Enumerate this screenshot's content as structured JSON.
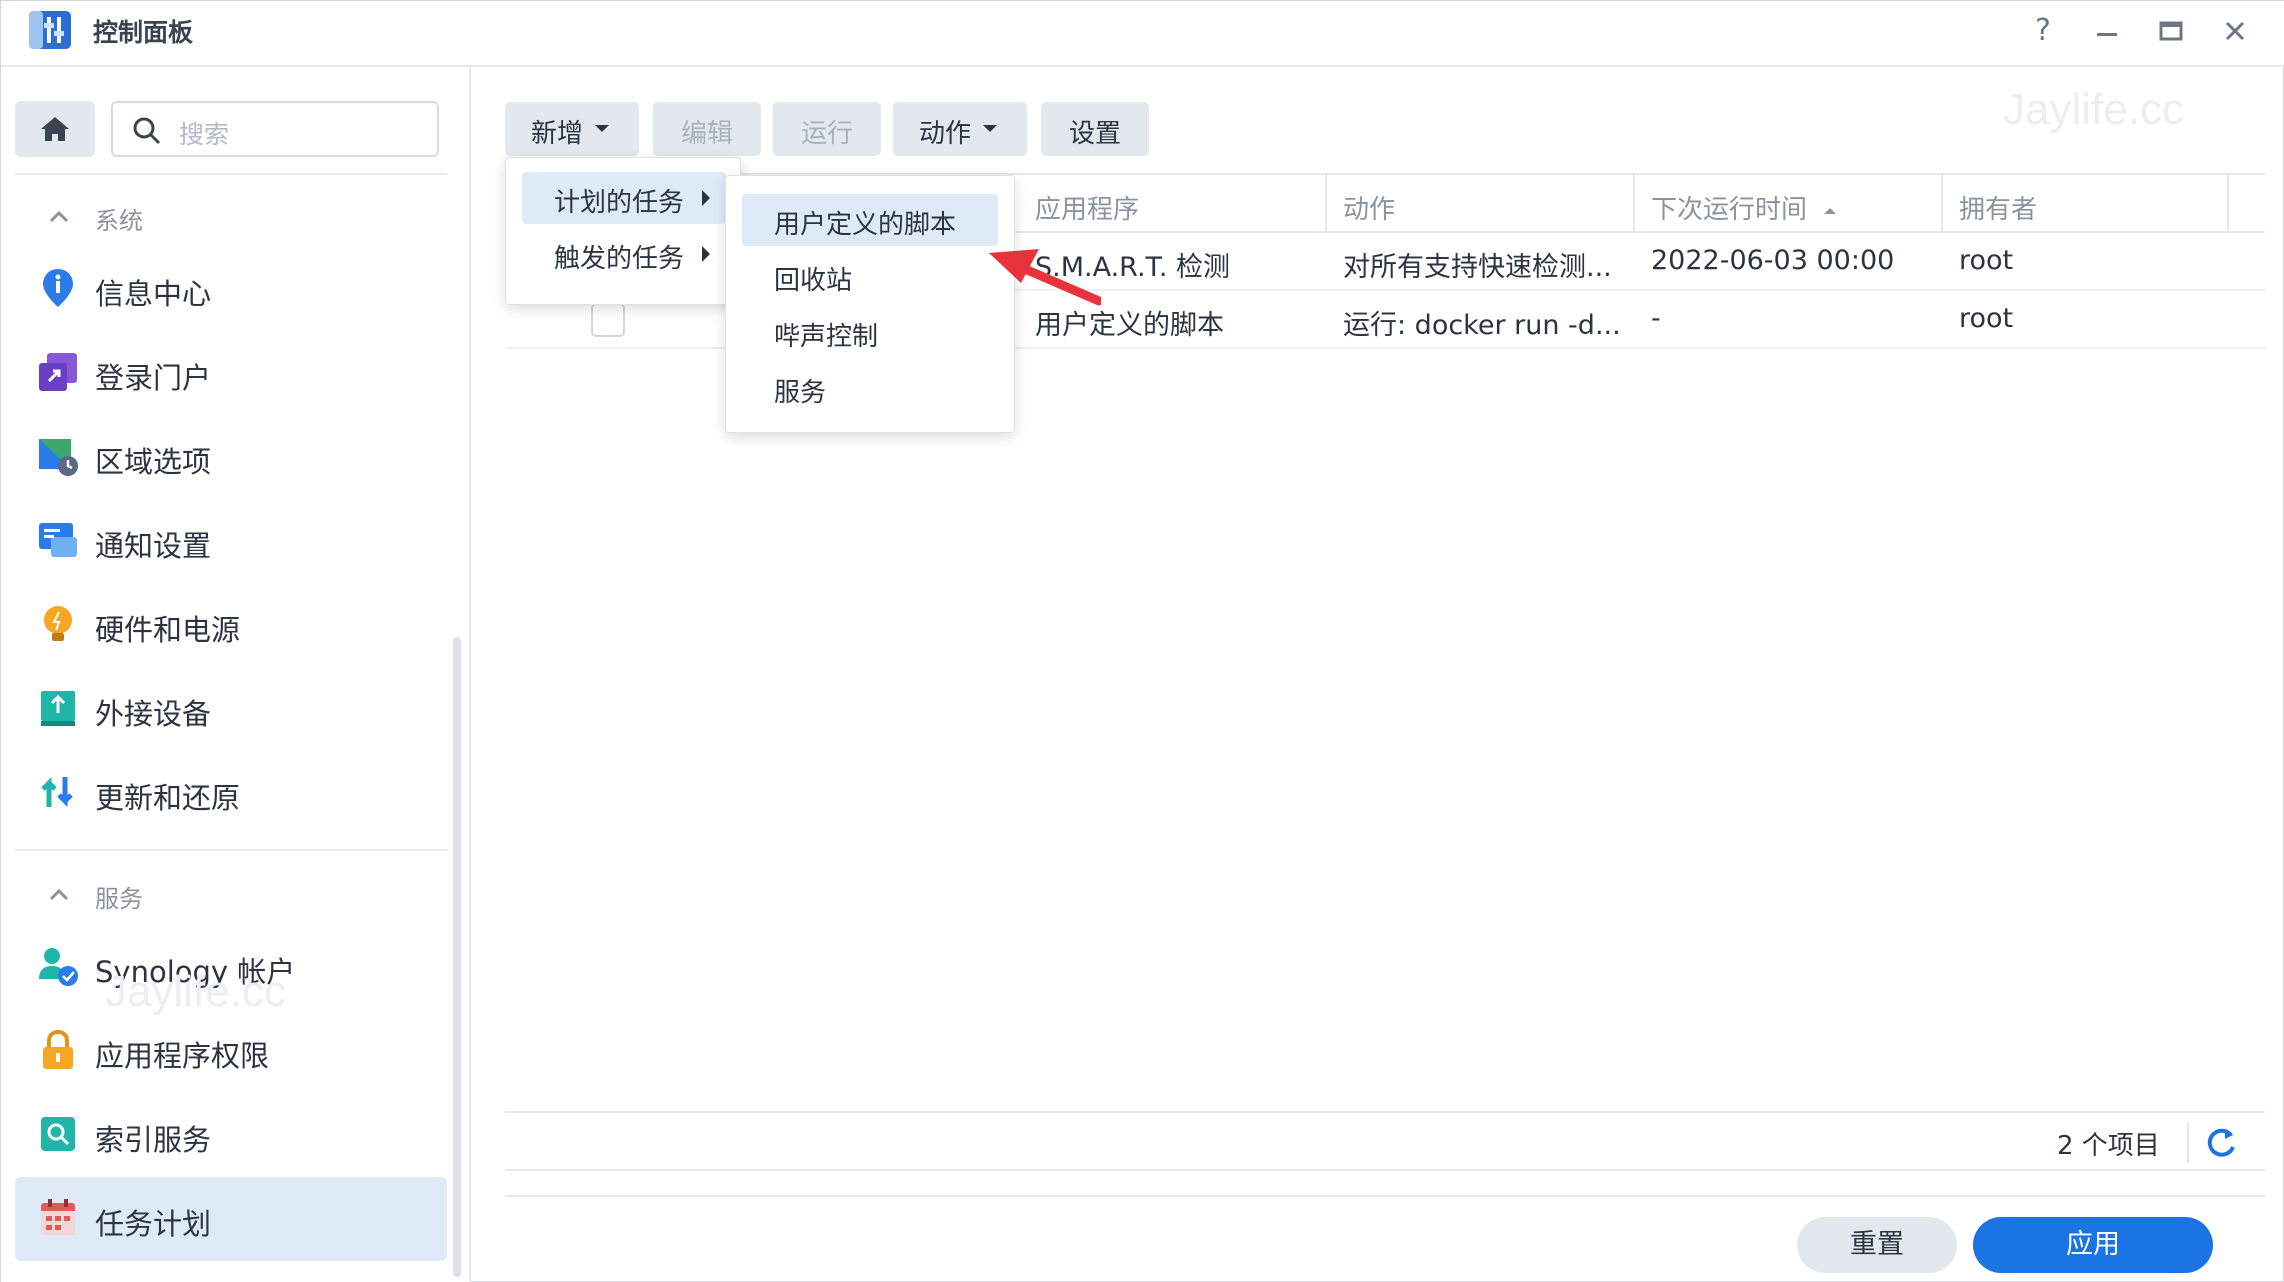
{
  "window": {
    "title": "控制面板",
    "help": "?",
    "minimize": "—",
    "maximize": "▭",
    "close": "✕"
  },
  "sidebar": {
    "search_placeholder": "搜索",
    "section_system": "系统",
    "section_services": "服务",
    "items": [
      {
        "label": "信息中心",
        "icon": "info-icon"
      },
      {
        "label": "登录门户",
        "icon": "login-portal-icon"
      },
      {
        "label": "区域选项",
        "icon": "regional-options-icon"
      },
      {
        "label": "通知设置",
        "icon": "notification-icon"
      },
      {
        "label": "硬件和电源",
        "icon": "hardware-power-icon"
      },
      {
        "label": "外接设备",
        "icon": "external-device-icon"
      },
      {
        "label": "更新和还原",
        "icon": "update-restore-icon"
      },
      {
        "label": "Synology 帐户",
        "icon": "synology-account-icon"
      },
      {
        "label": "应用程序权限",
        "icon": "app-privileges-icon"
      },
      {
        "label": "索引服务",
        "icon": "indexing-service-icon"
      },
      {
        "label": "任务计划",
        "icon": "task-scheduler-icon"
      }
    ]
  },
  "toolbar": {
    "create": "新增",
    "edit": "编辑",
    "run": "运行",
    "action": "动作",
    "settings": "设置"
  },
  "watermark": "Jaylife.cc",
  "grid": {
    "columns": {
      "application": "应用程序",
      "action": "动作",
      "next_run": "下次运行时间",
      "owner": "拥有者"
    },
    "rows": [
      {
        "application": "S.M.A.R.T. 检测",
        "action": "对所有支持快速检测...",
        "next_run": "2022-06-03 00:00",
        "owner": "root"
      },
      {
        "application": "用户定义的脚本",
        "action": "运行: docker run -d...",
        "next_run": "-",
        "owner": "root"
      }
    ]
  },
  "create_menu": {
    "scheduled": "计划的任务",
    "triggered": "触发的任务"
  },
  "scheduled_submenu": [
    "用户定义的脚本",
    "回收站",
    "哔声控制",
    "服务"
  ],
  "footer": {
    "count": "2 个项目",
    "reset": "重置",
    "apply": "应用"
  },
  "colors": {
    "accent": "#1a74e4",
    "highlight": "#dfeaf8",
    "annotation_arrow": "#e8333a"
  }
}
